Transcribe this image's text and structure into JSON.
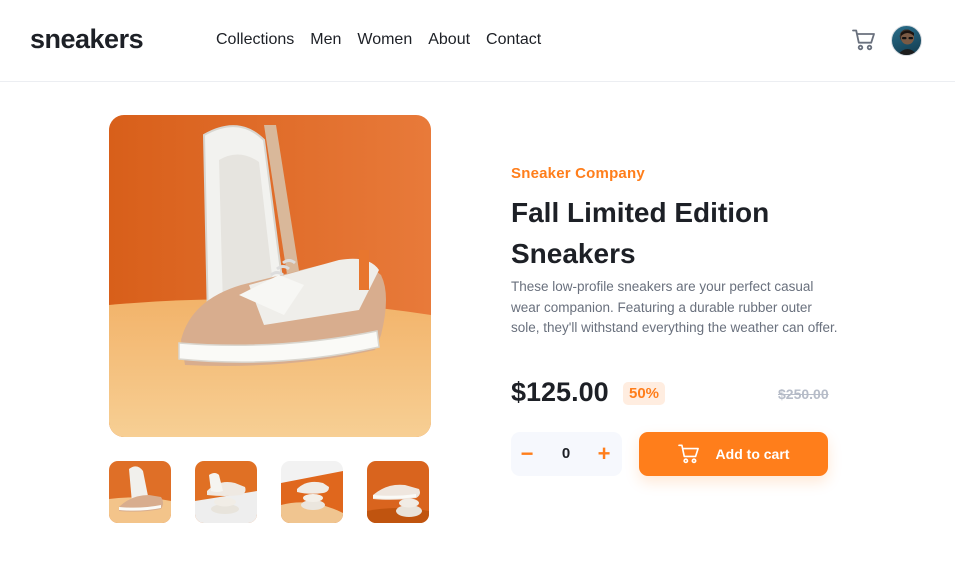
{
  "header": {
    "logo": "sneakers",
    "nav": [
      "Collections",
      "Men",
      "Women",
      "About",
      "Contact"
    ],
    "cart_icon": "cart-icon",
    "avatar_icon": "avatar"
  },
  "product": {
    "company": "Sneaker Company",
    "title_line1": "Fall Limited Edition",
    "title_line2": "Sneakers",
    "description": "These low-profile sneakers are your perfect casual wear companion. Featuring a durable rubber outer sole, they'll withstand everything the weather can offer.",
    "price": "$125.00",
    "discount": "50%",
    "old_price": "$250.00"
  },
  "cart": {
    "minus": "−",
    "quantity": "0",
    "plus": "+",
    "add_label": "Add to cart"
  },
  "colors": {
    "accent": "#ff7e1b",
    "accent_pale": "#ffede0",
    "text_dark": "#1d2026",
    "text_gray": "#69707d",
    "text_light": "#b6bcc8"
  }
}
